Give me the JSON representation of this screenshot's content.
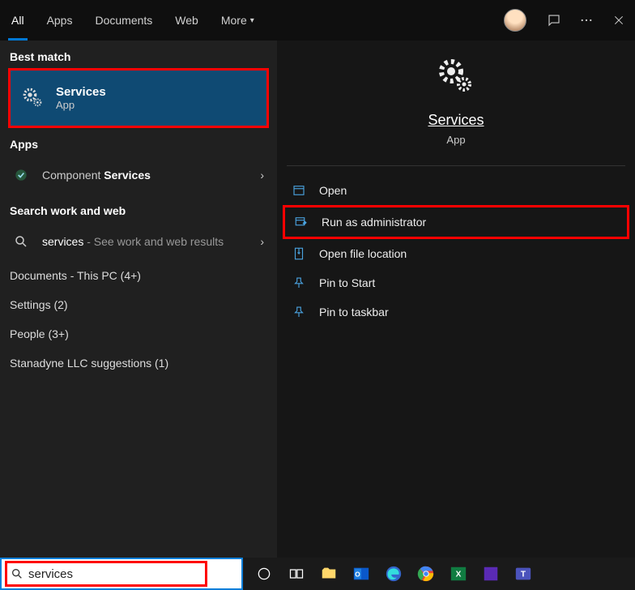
{
  "tabs": {
    "items": [
      "All",
      "Apps",
      "Documents",
      "Web",
      "More"
    ],
    "active": 0
  },
  "left": {
    "best_match_label": "Best match",
    "best_match": {
      "title": "Services",
      "subtitle": "App"
    },
    "apps_label": "Apps",
    "apps_result": {
      "prefix": "Component ",
      "boldpart": "Services"
    },
    "searchweb_label": "Search work and web",
    "web_result": {
      "term": "services",
      "suffix": " - See work and web results"
    },
    "extra": [
      "Documents - This PC (4+)",
      "Settings (2)",
      "People (3+)",
      "Stanadyne LLC suggestions (1)"
    ]
  },
  "right": {
    "title": "Services",
    "subtitle": "App",
    "actions": {
      "open": "Open",
      "admin": "Run as administrator",
      "location": "Open file location",
      "pin_start": "Pin to Start",
      "pin_taskbar": "Pin to taskbar"
    }
  },
  "search": {
    "value": "services"
  }
}
